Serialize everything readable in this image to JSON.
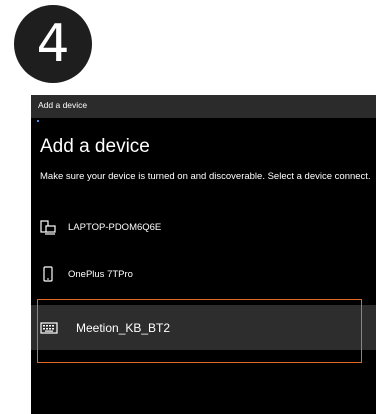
{
  "step": {
    "number": "4"
  },
  "dialog": {
    "window_title": "Add a device",
    "heading": "Add a device",
    "instructions": "Make sure your device is turned on and discoverable. Select a device connect.",
    "devices": [
      {
        "name": "LAPTOP-PDOM6Q6E",
        "icon": "laptop-icon"
      },
      {
        "name": "OnePlus 7TPro",
        "icon": "phone-icon"
      },
      {
        "name": "Meetion_KB_BT2",
        "icon": "keyboard-icon",
        "highlighted": true
      }
    ]
  },
  "colors": {
    "dialog_background": "#000000",
    "selected_row": "#2d2d2d",
    "highlight_border": "#e36a25",
    "badge": "#1e1e1e"
  }
}
